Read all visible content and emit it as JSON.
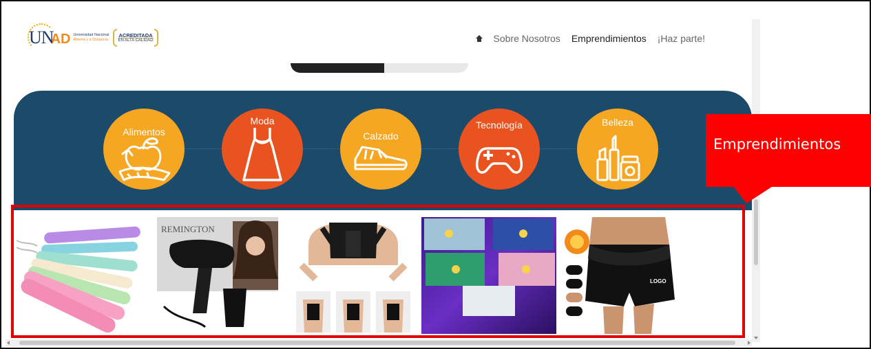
{
  "header": {
    "logo_un": "UN",
    "logo_ad": "AD",
    "logo_line1": "Universidad Nacional",
    "logo_line2": "Abierta y a Distancia",
    "accred_title": "ACREDITADA",
    "accred_sub": "EN ALTA CALIDAD"
  },
  "nav": {
    "home_icon": "home-icon",
    "items": [
      "Sobre Nosotros",
      "Emprendimientos",
      "¡Haz parte!"
    ],
    "active": "Emprendimientos"
  },
  "categories": [
    {
      "label": "Alimentos",
      "icon": "fruit-basket-icon",
      "color": "#f5a623"
    },
    {
      "label": "Moda",
      "icon": "dress-icon",
      "color": "#e8531f"
    },
    {
      "label": "Calzado",
      "icon": "sneaker-icon",
      "color": "#f5a623"
    },
    {
      "label": "Tecnología",
      "icon": "gamepad-icon",
      "color": "#e8531f"
    },
    {
      "label": "Belleza",
      "icon": "cosmetics-icon",
      "color": "#f5a623"
    }
  ],
  "products": [
    {
      "name": "hair-straighteners",
      "icon": "hair-straightener-image"
    },
    {
      "name": "remington-hair-dryer",
      "icon": "hair-dryer-image",
      "brand_text": "REMINGTON"
    },
    {
      "name": "posture-corrector",
      "icon": "posture-brace-image"
    },
    {
      "name": "printed-hoodies",
      "icon": "hoodies-image"
    },
    {
      "name": "waist-trainer-shorts",
      "icon": "waist-trainer-image",
      "logo_text": "LOGO"
    }
  ],
  "callout": {
    "text": "Emprendimientos"
  },
  "colors": {
    "band": "#1b4a6b",
    "orange": "#f5a623",
    "red_orange": "#e8531f",
    "highlight": "#e10000",
    "callout": "#ff0000"
  }
}
